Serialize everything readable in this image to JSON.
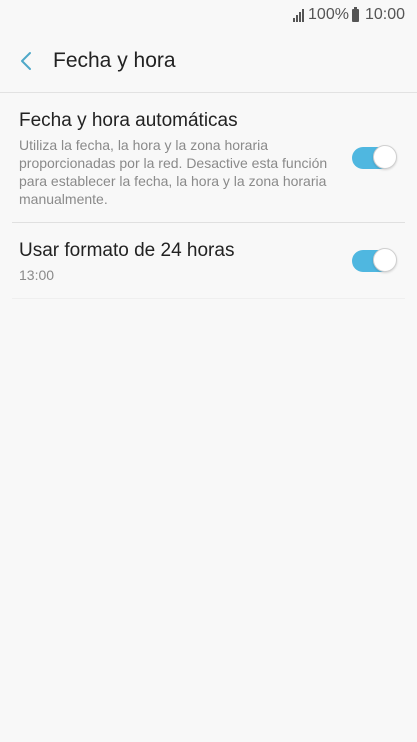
{
  "status_bar": {
    "battery_percent": "100%",
    "time": "10:00",
    "icons": [
      "signal-icon",
      "battery-icon"
    ]
  },
  "header": {
    "back_icon": "chevron-left-icon",
    "title": "Fecha y hora"
  },
  "settings": [
    {
      "title": "Fecha y hora automáticas",
      "subtitle": "Utiliza la fecha, la hora y la zona horaria proporcionadas por la red. Desactive esta función para establecer la fecha, la hora y la zona horaria manualmente.",
      "toggle_on": true
    },
    {
      "title": "Usar formato de 24 horas",
      "subtitle": "13:00",
      "toggle_on": true
    }
  ],
  "colors": {
    "accent": "#4fb7e0",
    "background": "#f8f8f8"
  }
}
